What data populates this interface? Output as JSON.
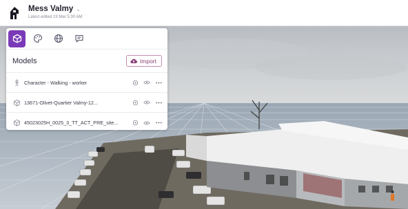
{
  "header": {
    "project_title": "Mess Valmy",
    "subtitle": "Latest edited 19 Mar 5:30 AM",
    "title_dropdown_icon": "chevron-down-icon"
  },
  "panel": {
    "tabs": [
      {
        "name": "models",
        "icon": "cube-icon",
        "active": true
      },
      {
        "name": "appearance",
        "icon": "palette-icon",
        "active": false
      },
      {
        "name": "environment",
        "icon": "globe-icon",
        "active": false
      },
      {
        "name": "annotations",
        "icon": "comment-icon",
        "active": false
      }
    ],
    "section_title": "Models",
    "import_label": "Import",
    "models": [
      {
        "name": "Character - Walking - worker",
        "icon": "character-icon"
      },
      {
        "name": "13671-Olivet-Quartier Valmy-12...",
        "icon": "cube-icon"
      },
      {
        "name": "45023025H_0025_3_TT_ACT_PRE_site...",
        "icon": "cube-icon"
      }
    ],
    "row_actions": [
      "target-icon",
      "eye-icon",
      "more-icon"
    ]
  },
  "colors": {
    "accent": "#7a3ab8",
    "import_border": "#c58ab0",
    "import_text": "#8a3f78"
  }
}
